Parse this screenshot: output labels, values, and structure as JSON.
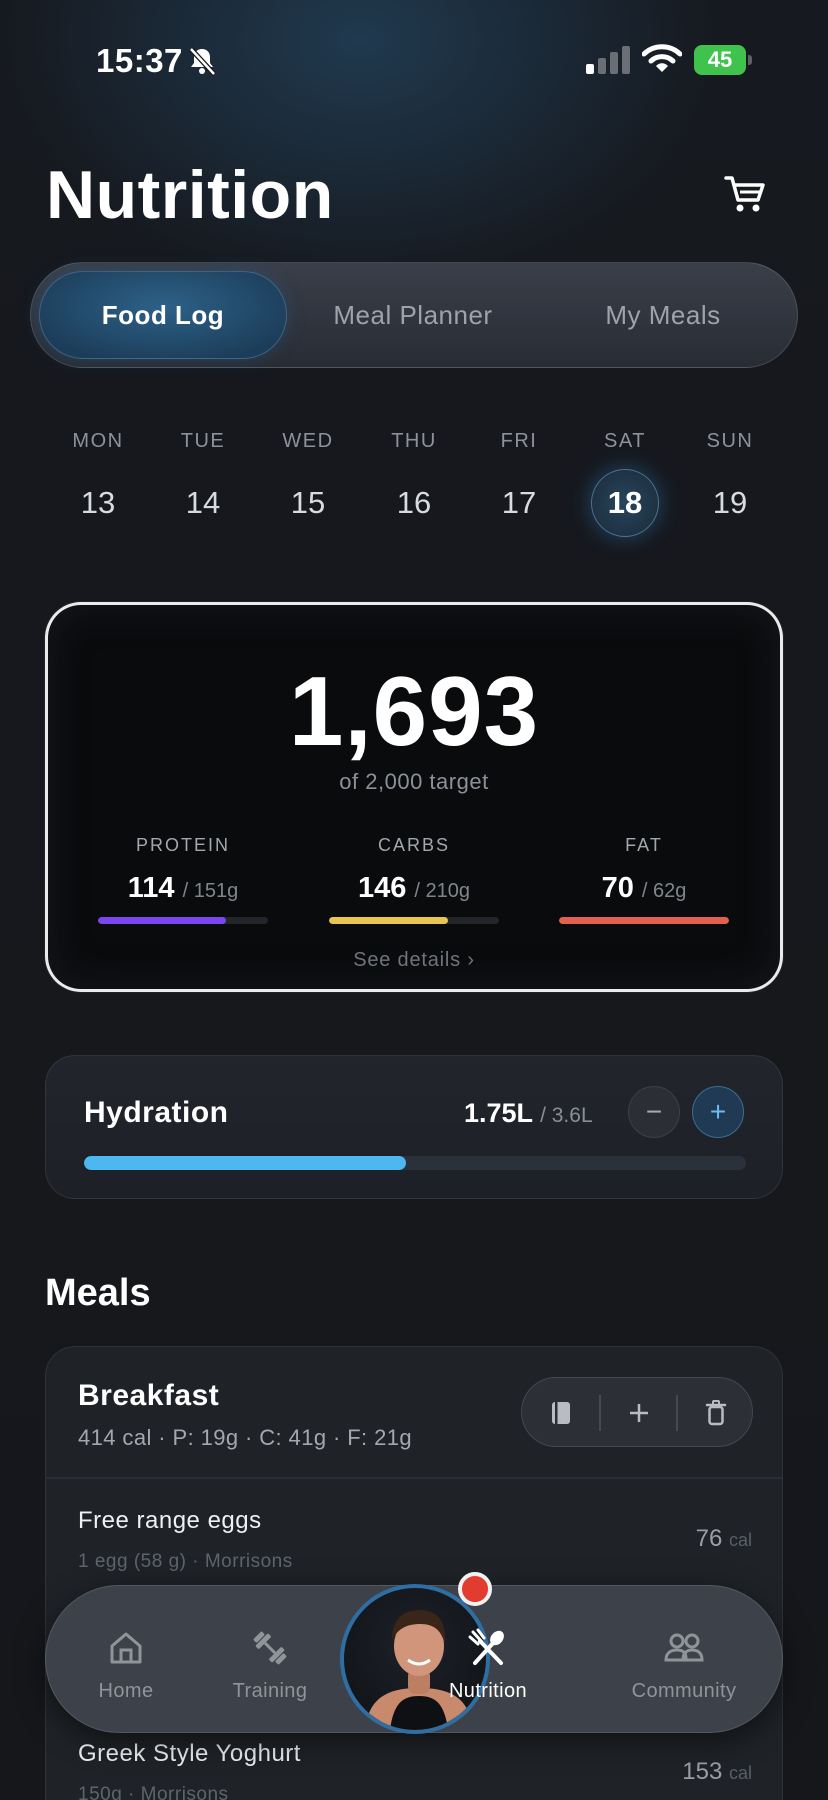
{
  "status_bar": {
    "time": "15:37",
    "battery": "45"
  },
  "header": {
    "title": "Nutrition"
  },
  "tabs": [
    {
      "label": "Food Log",
      "active": true
    },
    {
      "label": "Meal Planner",
      "active": false
    },
    {
      "label": "My Meals",
      "active": false
    }
  ],
  "week": [
    {
      "day": "MON",
      "date": "13"
    },
    {
      "day": "TUE",
      "date": "14"
    },
    {
      "day": "WED",
      "date": "15"
    },
    {
      "day": "THU",
      "date": "16"
    },
    {
      "day": "FRI",
      "date": "17"
    },
    {
      "day": "SAT",
      "date": "18",
      "selected": true
    },
    {
      "day": "SUN",
      "date": "19"
    }
  ],
  "calories": {
    "value": "1,693",
    "target_text": "of 2,000 target",
    "see_details": "See details ›"
  },
  "macros": [
    {
      "label": "PROTEIN",
      "value": "114",
      "target": "/ 151g",
      "progress": 0.75,
      "color": "#7b46f0"
    },
    {
      "label": "CARBS",
      "value": "146",
      "target": "/ 210g",
      "progress": 0.7,
      "color": "#e8c54e"
    },
    {
      "label": "FAT",
      "value": "70",
      "target": "/ 62g",
      "progress": 1.0,
      "color": "#e3604c"
    }
  ],
  "hydration": {
    "title": "Hydration",
    "amount": "1.75L",
    "target": "/ 3.6L",
    "minus": "−",
    "plus": "+",
    "progress": 0.486
  },
  "meals_section": {
    "title": "Meals"
  },
  "meals": [
    {
      "name": "Breakfast",
      "summary": "414 cal  ·  P: 19g  ·  C: 41g  ·  F: 21g",
      "items": [
        {
          "name": "Free range eggs",
          "desc": "1 egg (58 g) · Morrisons",
          "cal": "76",
          "unit": "cal"
        },
        {
          "name": "Greek Style Yoghurt",
          "desc": "150g · Morrisons",
          "cal": "153",
          "unit": "cal"
        }
      ]
    }
  ],
  "nav": [
    {
      "label": "Home",
      "active": false,
      "icon": "home-icon"
    },
    {
      "label": "Training",
      "active": false,
      "icon": "dumbbell-icon"
    },
    {
      "label": "Nutrition",
      "active": true,
      "icon": "utensils-icon"
    },
    {
      "label": "Community",
      "active": false,
      "icon": "people-icon"
    }
  ],
  "colors": {
    "accent": "#4db7ef",
    "selected_tab": "#2d6188",
    "notification": "#e23b30"
  }
}
